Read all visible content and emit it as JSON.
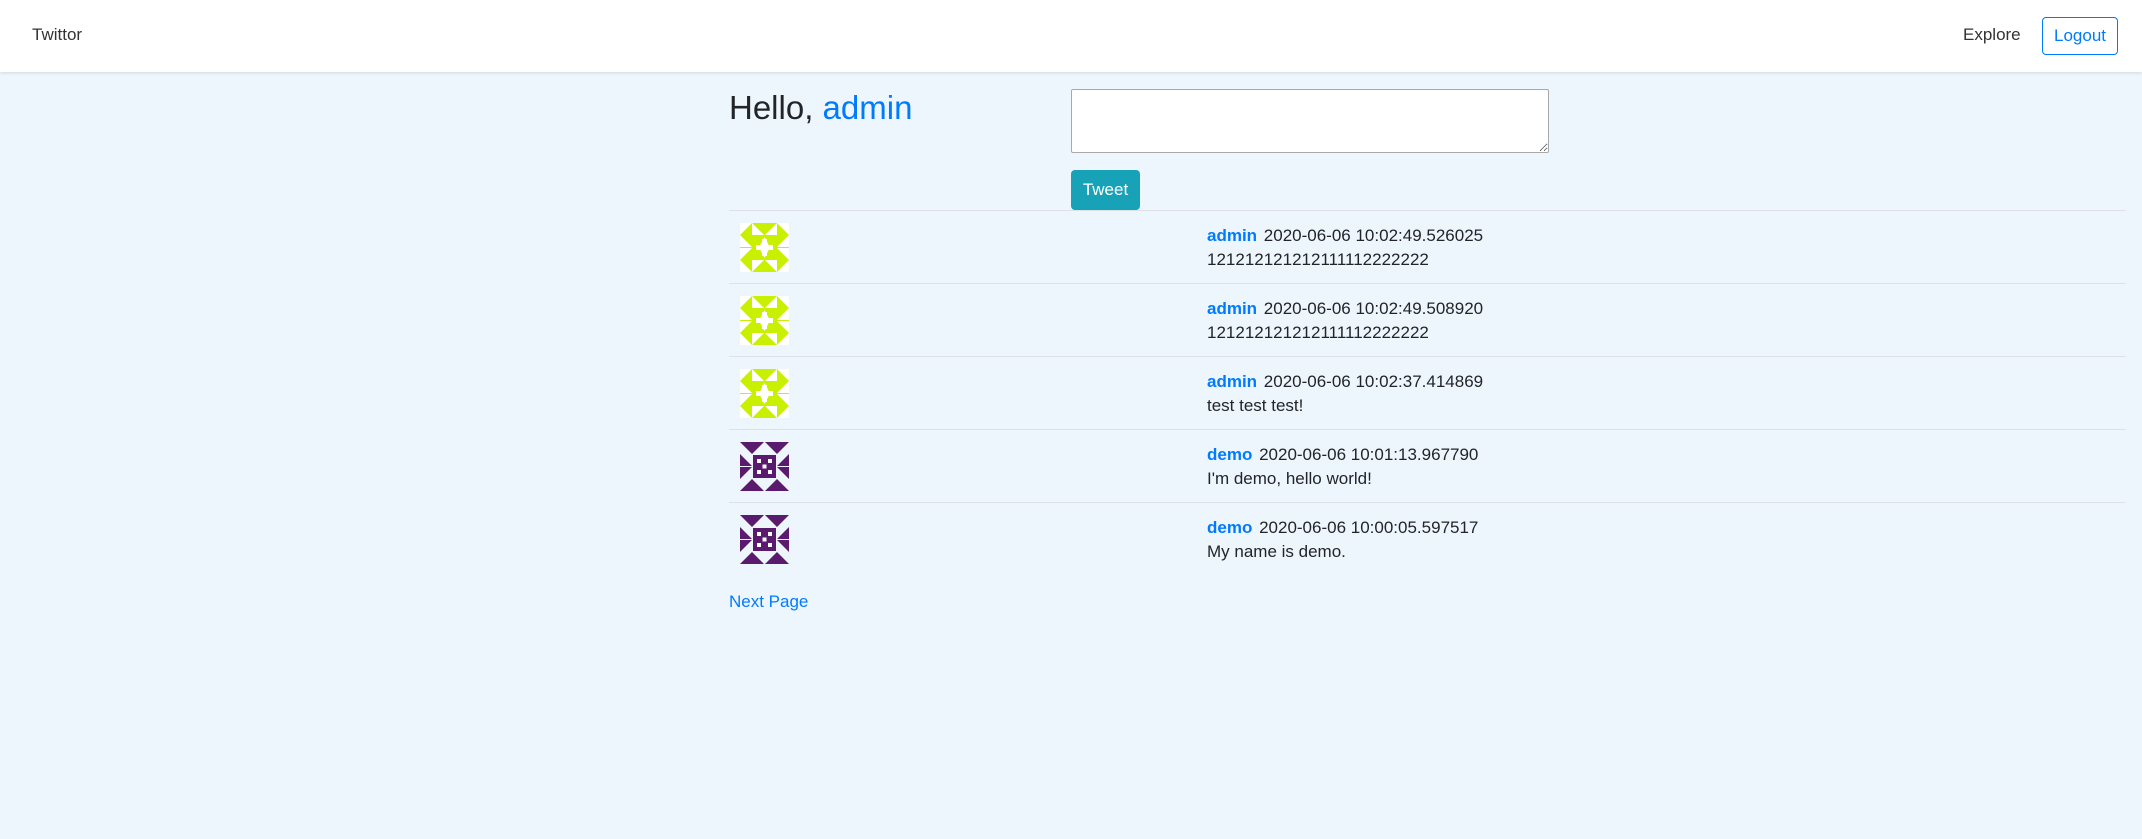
{
  "navbar": {
    "brand": "Twittor",
    "explore": "Explore",
    "logout": "Logout"
  },
  "greeting": {
    "prefix": "Hello,",
    "username": "admin"
  },
  "composer": {
    "value": "",
    "button_label": "Tweet"
  },
  "colors": {
    "accent": "#007bff",
    "tweet_button": "#17a2b8",
    "background": "#eef6fd",
    "avatar_admin": "#c8f000",
    "avatar_demo": "#5a1a6e"
  },
  "posts": [
    {
      "author": "admin",
      "timestamp": "2020-06-06 10:02:49.526025",
      "text": "121212121212111112222222",
      "avatar": "admin-identicon"
    },
    {
      "author": "admin",
      "timestamp": "2020-06-06 10:02:49.508920",
      "text": "121212121212111112222222",
      "avatar": "admin-identicon"
    },
    {
      "author": "admin",
      "timestamp": "2020-06-06 10:02:37.414869",
      "text": "test test test!",
      "avatar": "admin-identicon"
    },
    {
      "author": "demo",
      "timestamp": "2020-06-06 10:01:13.967790",
      "text": "I'm demo, hello world!",
      "avatar": "demo-identicon"
    },
    {
      "author": "demo",
      "timestamp": "2020-06-06 10:00:05.597517",
      "text": "My name is demo.",
      "avatar": "demo-identicon"
    }
  ],
  "pagination": {
    "next_label": "Next Page"
  }
}
